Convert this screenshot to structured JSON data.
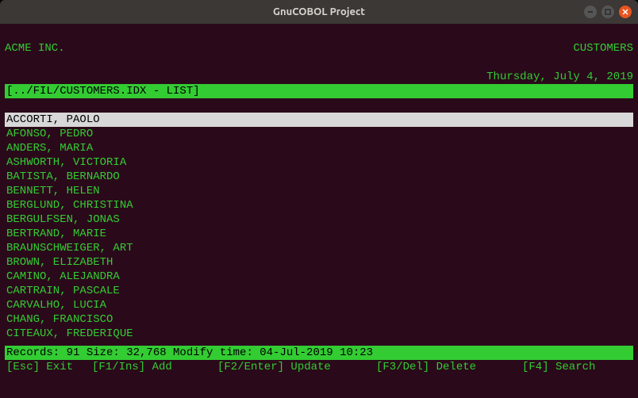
{
  "window": {
    "title": "GnuCOBOL Project"
  },
  "header": {
    "company": "ACME INC.",
    "screen_name": "CUSTOMERS",
    "date": "Thursday, July 4, 2019",
    "path_line": "[../FIL/CUSTOMERS.IDX - LIST]"
  },
  "list": {
    "selected_index": 0,
    "items": [
      "ACCORTI, PAOLO",
      "AFONSO, PEDRO",
      "ANDERS, MARIA",
      "ASHWORTH, VICTORIA",
      "BATISTA, BERNARDO",
      "BENNETT, HELEN",
      "BERGLUND, CHRISTINA",
      "BERGULFSEN, JONAS",
      "BERTRAND, MARIE",
      "BRAUNSCHWEIGER, ART",
      "BROWN, ELIZABETH",
      "CAMINO, ALEJANDRA",
      "CARTRAIN, PASCALE",
      "CARVALHO, LUCIA",
      "CHANG, FRANCISCO",
      "CITEAUX, FREDERIQUE"
    ]
  },
  "status": {
    "line": "Records: 91 Size: 32,768 Modify time: 04-Jul-2019 10:23",
    "records": 91,
    "size": "32,768",
    "modify_time": "04-Jul-2019 10:23"
  },
  "fnkeys": {
    "esc": "[Esc] Exit",
    "f1": "[F1/Ins] Add",
    "f2": "[F2/Enter] Update",
    "f3": "[F3/Del] Delete",
    "f4": "[F4] Search"
  }
}
